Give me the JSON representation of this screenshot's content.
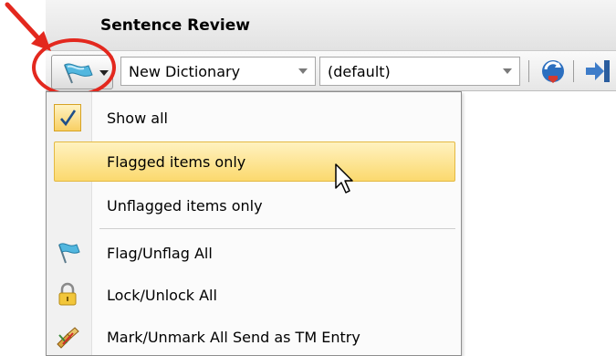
{
  "panel": {
    "title": "Sentence Review"
  },
  "toolbar": {
    "flag_button_icon": "flag-icon",
    "dictionary_combo": {
      "value": "New Dictionary"
    },
    "default_combo": {
      "value": "(default)"
    },
    "icons": [
      "update-icon",
      "confirm-icon"
    ]
  },
  "menu": {
    "items": [
      {
        "label": "Show all",
        "checked": true,
        "icon": "check-icon"
      },
      {
        "label": "Flagged items only",
        "highlighted": true
      },
      {
        "label": "Unflagged items only"
      },
      {
        "label": "Flag/Unflag All",
        "icon": "flag-icon"
      },
      {
        "label": "Lock/Unlock All",
        "icon": "lock-icon"
      },
      {
        "label": "Mark/Unmark All Send as TM Entry",
        "icon": "mark-tm-icon"
      }
    ]
  },
  "colors": {
    "annotation_red": "#e3281e",
    "highlight_top": "#fff2c0",
    "highlight_bottom": "#fbd96e"
  }
}
